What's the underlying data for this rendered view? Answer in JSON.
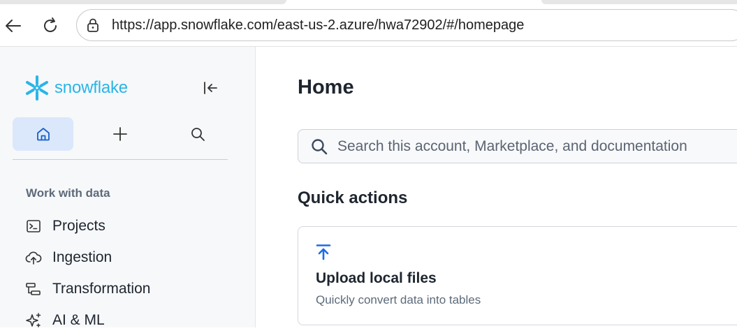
{
  "browser": {
    "url": "https://app.snowflake.com/east-us-2.azure/hwa72902/#/homepage",
    "back_icon": "arrow-left-icon",
    "reload_icon": "reload-icon",
    "site_info_icon": "site-info-lock-icon"
  },
  "sidebar": {
    "brand": "snowflake",
    "brand_color": "#29b5e8",
    "collapse_icon": "collapse-sidebar-icon",
    "quick_buttons": [
      {
        "icon": "home-icon",
        "active": true
      },
      {
        "icon": "plus-icon",
        "active": false
      },
      {
        "icon": "search-icon",
        "active": false
      }
    ],
    "section_label": "Work with data",
    "items": [
      {
        "label": "Projects",
        "icon": "terminal-icon"
      },
      {
        "label": "Ingestion",
        "icon": "cloud-upload-icon"
      },
      {
        "label": "Transformation",
        "icon": "transform-icon"
      },
      {
        "label": "AI & ML",
        "icon": "sparkle-icon"
      }
    ]
  },
  "main": {
    "title": "Home",
    "search": {
      "placeholder": "Search this account, Marketplace, and documentation",
      "value": ""
    },
    "quick_actions_title": "Quick actions",
    "actions": [
      {
        "title": "Upload local files",
        "description": "Quickly convert data into tables",
        "icon": "upload-icon",
        "icon_color": "#1a6ce7"
      }
    ]
  },
  "colors": {
    "active_bg": "#dbe8fb",
    "accent_blue": "#1a6ce7"
  }
}
